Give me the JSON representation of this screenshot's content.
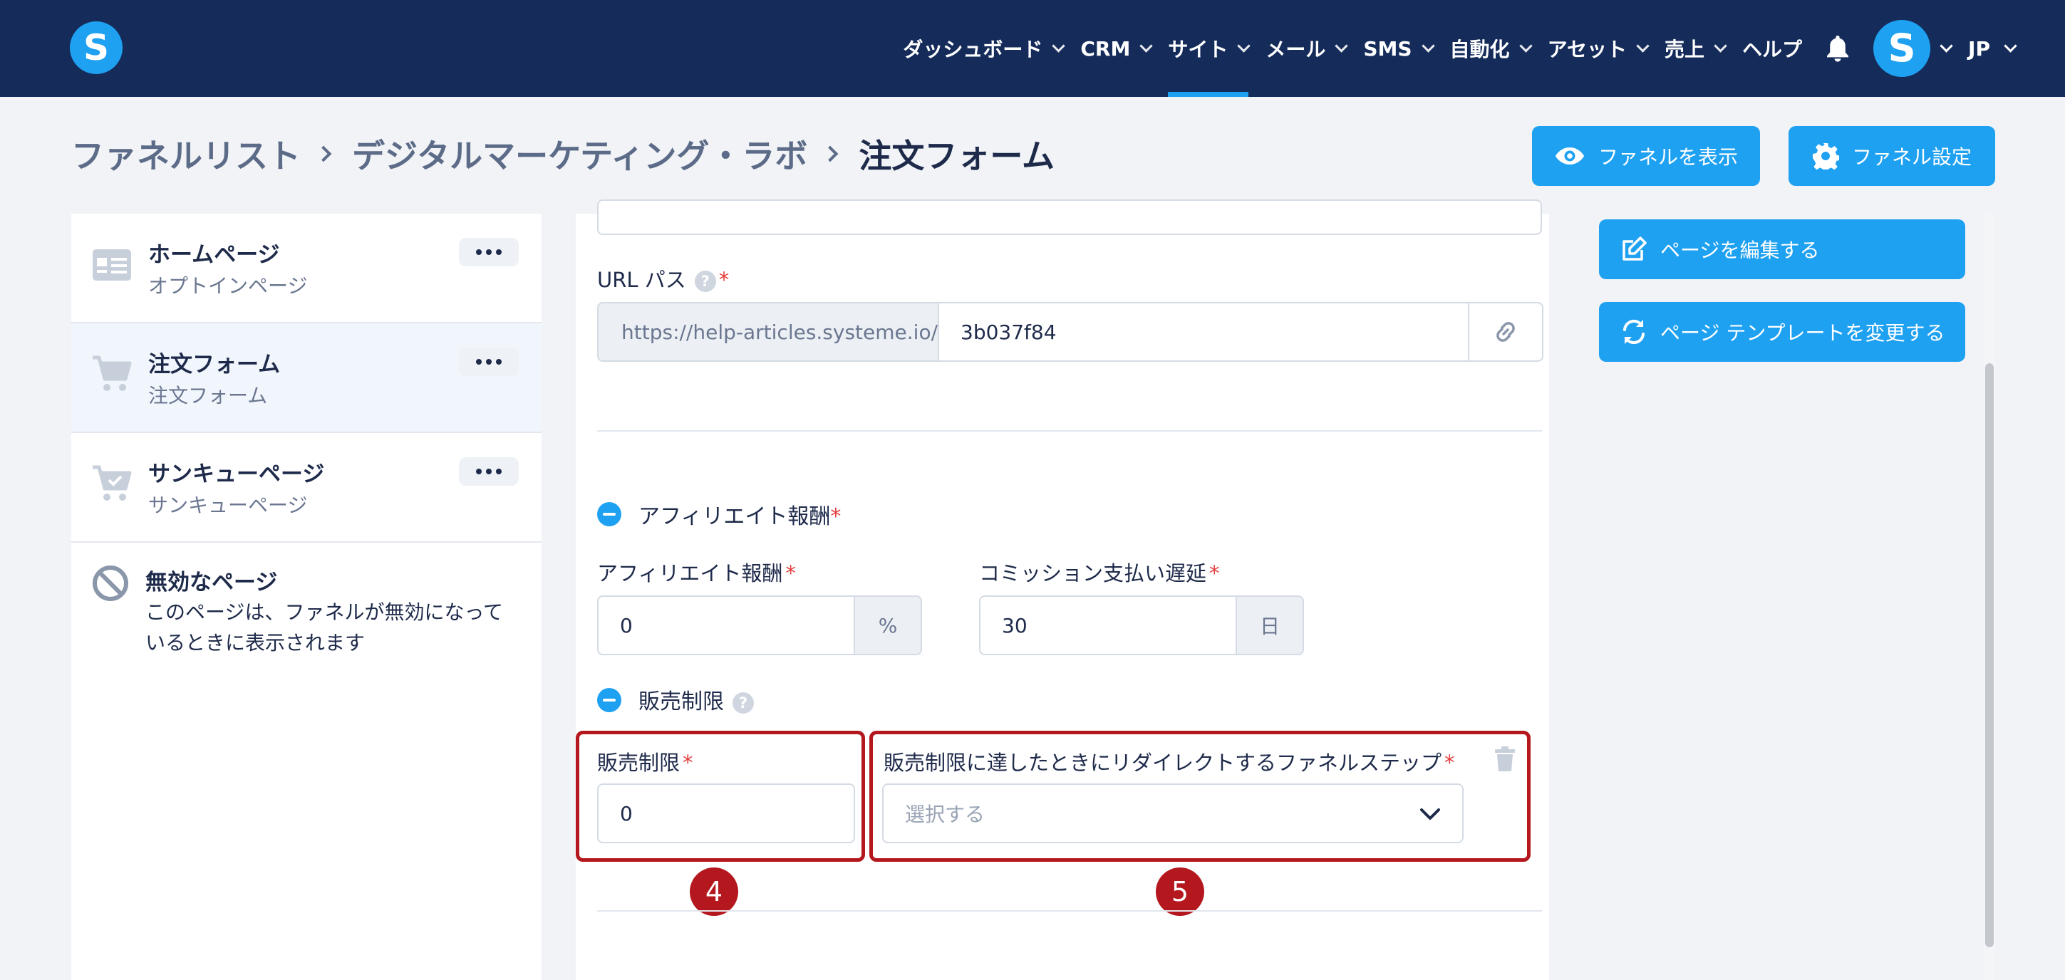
{
  "app": {
    "logo_letter": "S"
  },
  "nav": {
    "items": [
      {
        "label": "ダッシュボード",
        "active": false
      },
      {
        "label": "CRM",
        "active": false
      },
      {
        "label": "サイト",
        "active": true
      },
      {
        "label": "メール",
        "active": false
      },
      {
        "label": "SMS",
        "active": false
      },
      {
        "label": "自動化",
        "active": false
      },
      {
        "label": "アセット",
        "active": false
      },
      {
        "label": "売上",
        "active": false
      },
      {
        "label": "ヘルプ",
        "active": false
      }
    ],
    "avatar_letter": "S",
    "language": "JP"
  },
  "breadcrumb": {
    "items": [
      "ファネルリスト",
      "デジタルマーケティング・ラボ"
    ],
    "current": "注文フォーム"
  },
  "header_buttons": {
    "view_funnel": "ファネルを表示",
    "funnel_settings": "ファネル設定"
  },
  "sidebar": {
    "steps": [
      {
        "title": "ホームページ",
        "subtitle": "オプトインページ",
        "icon": "page-layout-icon"
      },
      {
        "title": "注文フォーム",
        "subtitle": "注文フォーム",
        "icon": "cart-icon",
        "active": true
      },
      {
        "title": "サンキューページ",
        "subtitle": "サンキューページ",
        "icon": "cart-check-icon"
      }
    ],
    "disabled_page": {
      "title": "無効なページ",
      "description": "このページは、ファネルが無効になっているときに表示されます"
    }
  },
  "form": {
    "url_path": {
      "label": "URL パス",
      "prefix": "https://help-articles.systeme.io/",
      "value": "3b037f84"
    },
    "affiliate_section": {
      "title": "アフィリエイト報酬",
      "commission_label": "アフィリエイト報酬",
      "commission_value": "0",
      "commission_unit": "%",
      "delay_label": "コミッション支払い遅延",
      "delay_value": "30",
      "delay_unit": "日"
    },
    "sales_limit_section": {
      "title": "販売制限",
      "limit_label": "販売制限",
      "limit_value": "0",
      "redirect_label": "販売制限に達したときにリダイレクトするファネルステップ",
      "redirect_placeholder": "選択する"
    }
  },
  "annotations": {
    "badge_4": "4",
    "badge_5": "5"
  },
  "right_actions": {
    "edit_page": "ページを編集する",
    "change_template": "ページ テンプレートを変更する"
  },
  "colors": {
    "navbar": "#152c5b",
    "accent": "#1fa1f2",
    "highlight": "#b4181e"
  }
}
